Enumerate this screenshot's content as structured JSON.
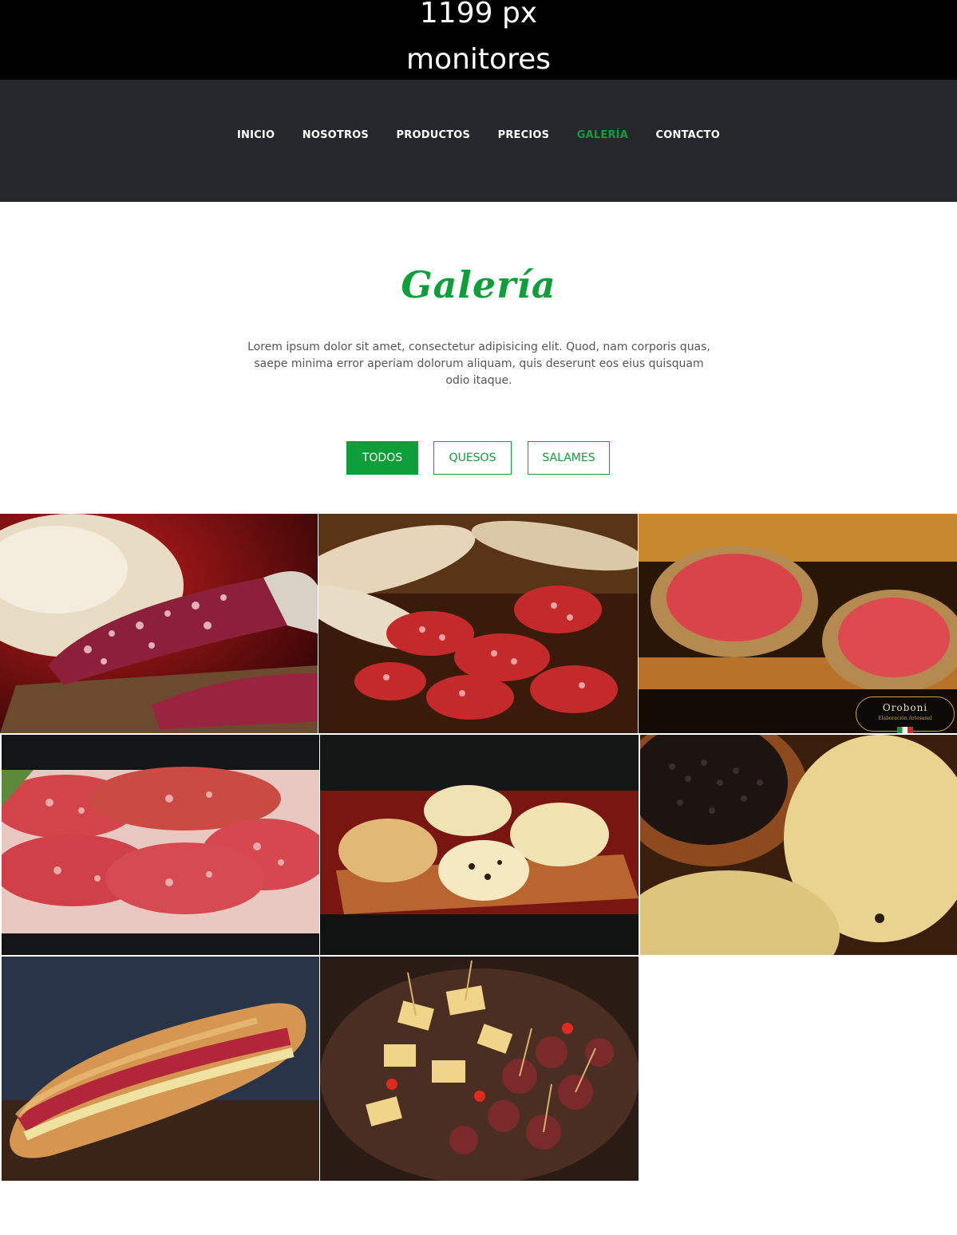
{
  "banner": {
    "line1": "1199 px",
    "line2": "monitores"
  },
  "nav": {
    "items": [
      {
        "label": "INICIO"
      },
      {
        "label": "NOSOTROS"
      },
      {
        "label": "PRODUCTOS"
      },
      {
        "label": "PRECIOS"
      },
      {
        "label": "GALERÍA",
        "active": true
      },
      {
        "label": "CONTACTO"
      }
    ]
  },
  "gallery": {
    "title": "Galería",
    "intro": "Lorem ipsum dolor sit amet, consectetur adipisicing elit. Quod, nam corporis quas, saepe minima error aperiam dolorum aliquam, quis deserunt eos eius quisquam odio itaque.",
    "filters": [
      {
        "label": "TODOS",
        "active": true
      },
      {
        "label": "QUESOS"
      },
      {
        "label": "SALAMES"
      }
    ],
    "images": [
      {
        "subject": "salame-with-bread"
      },
      {
        "subject": "sliced-salames"
      },
      {
        "subject": "salame-on-toast"
      },
      {
        "subject": "salame-slices"
      },
      {
        "subject": "cheese-wheels-on-board"
      },
      {
        "subject": "cheese-and-peppercorns"
      },
      {
        "subject": "salame-sandwich"
      },
      {
        "subject": "picada-platter"
      }
    ],
    "logo": {
      "name": "Oroboni",
      "tagline": "Elaboración Artesanal"
    }
  },
  "colors": {
    "accent": "#0e9e3a",
    "navbar": "#26272c",
    "banner": "#000000"
  }
}
